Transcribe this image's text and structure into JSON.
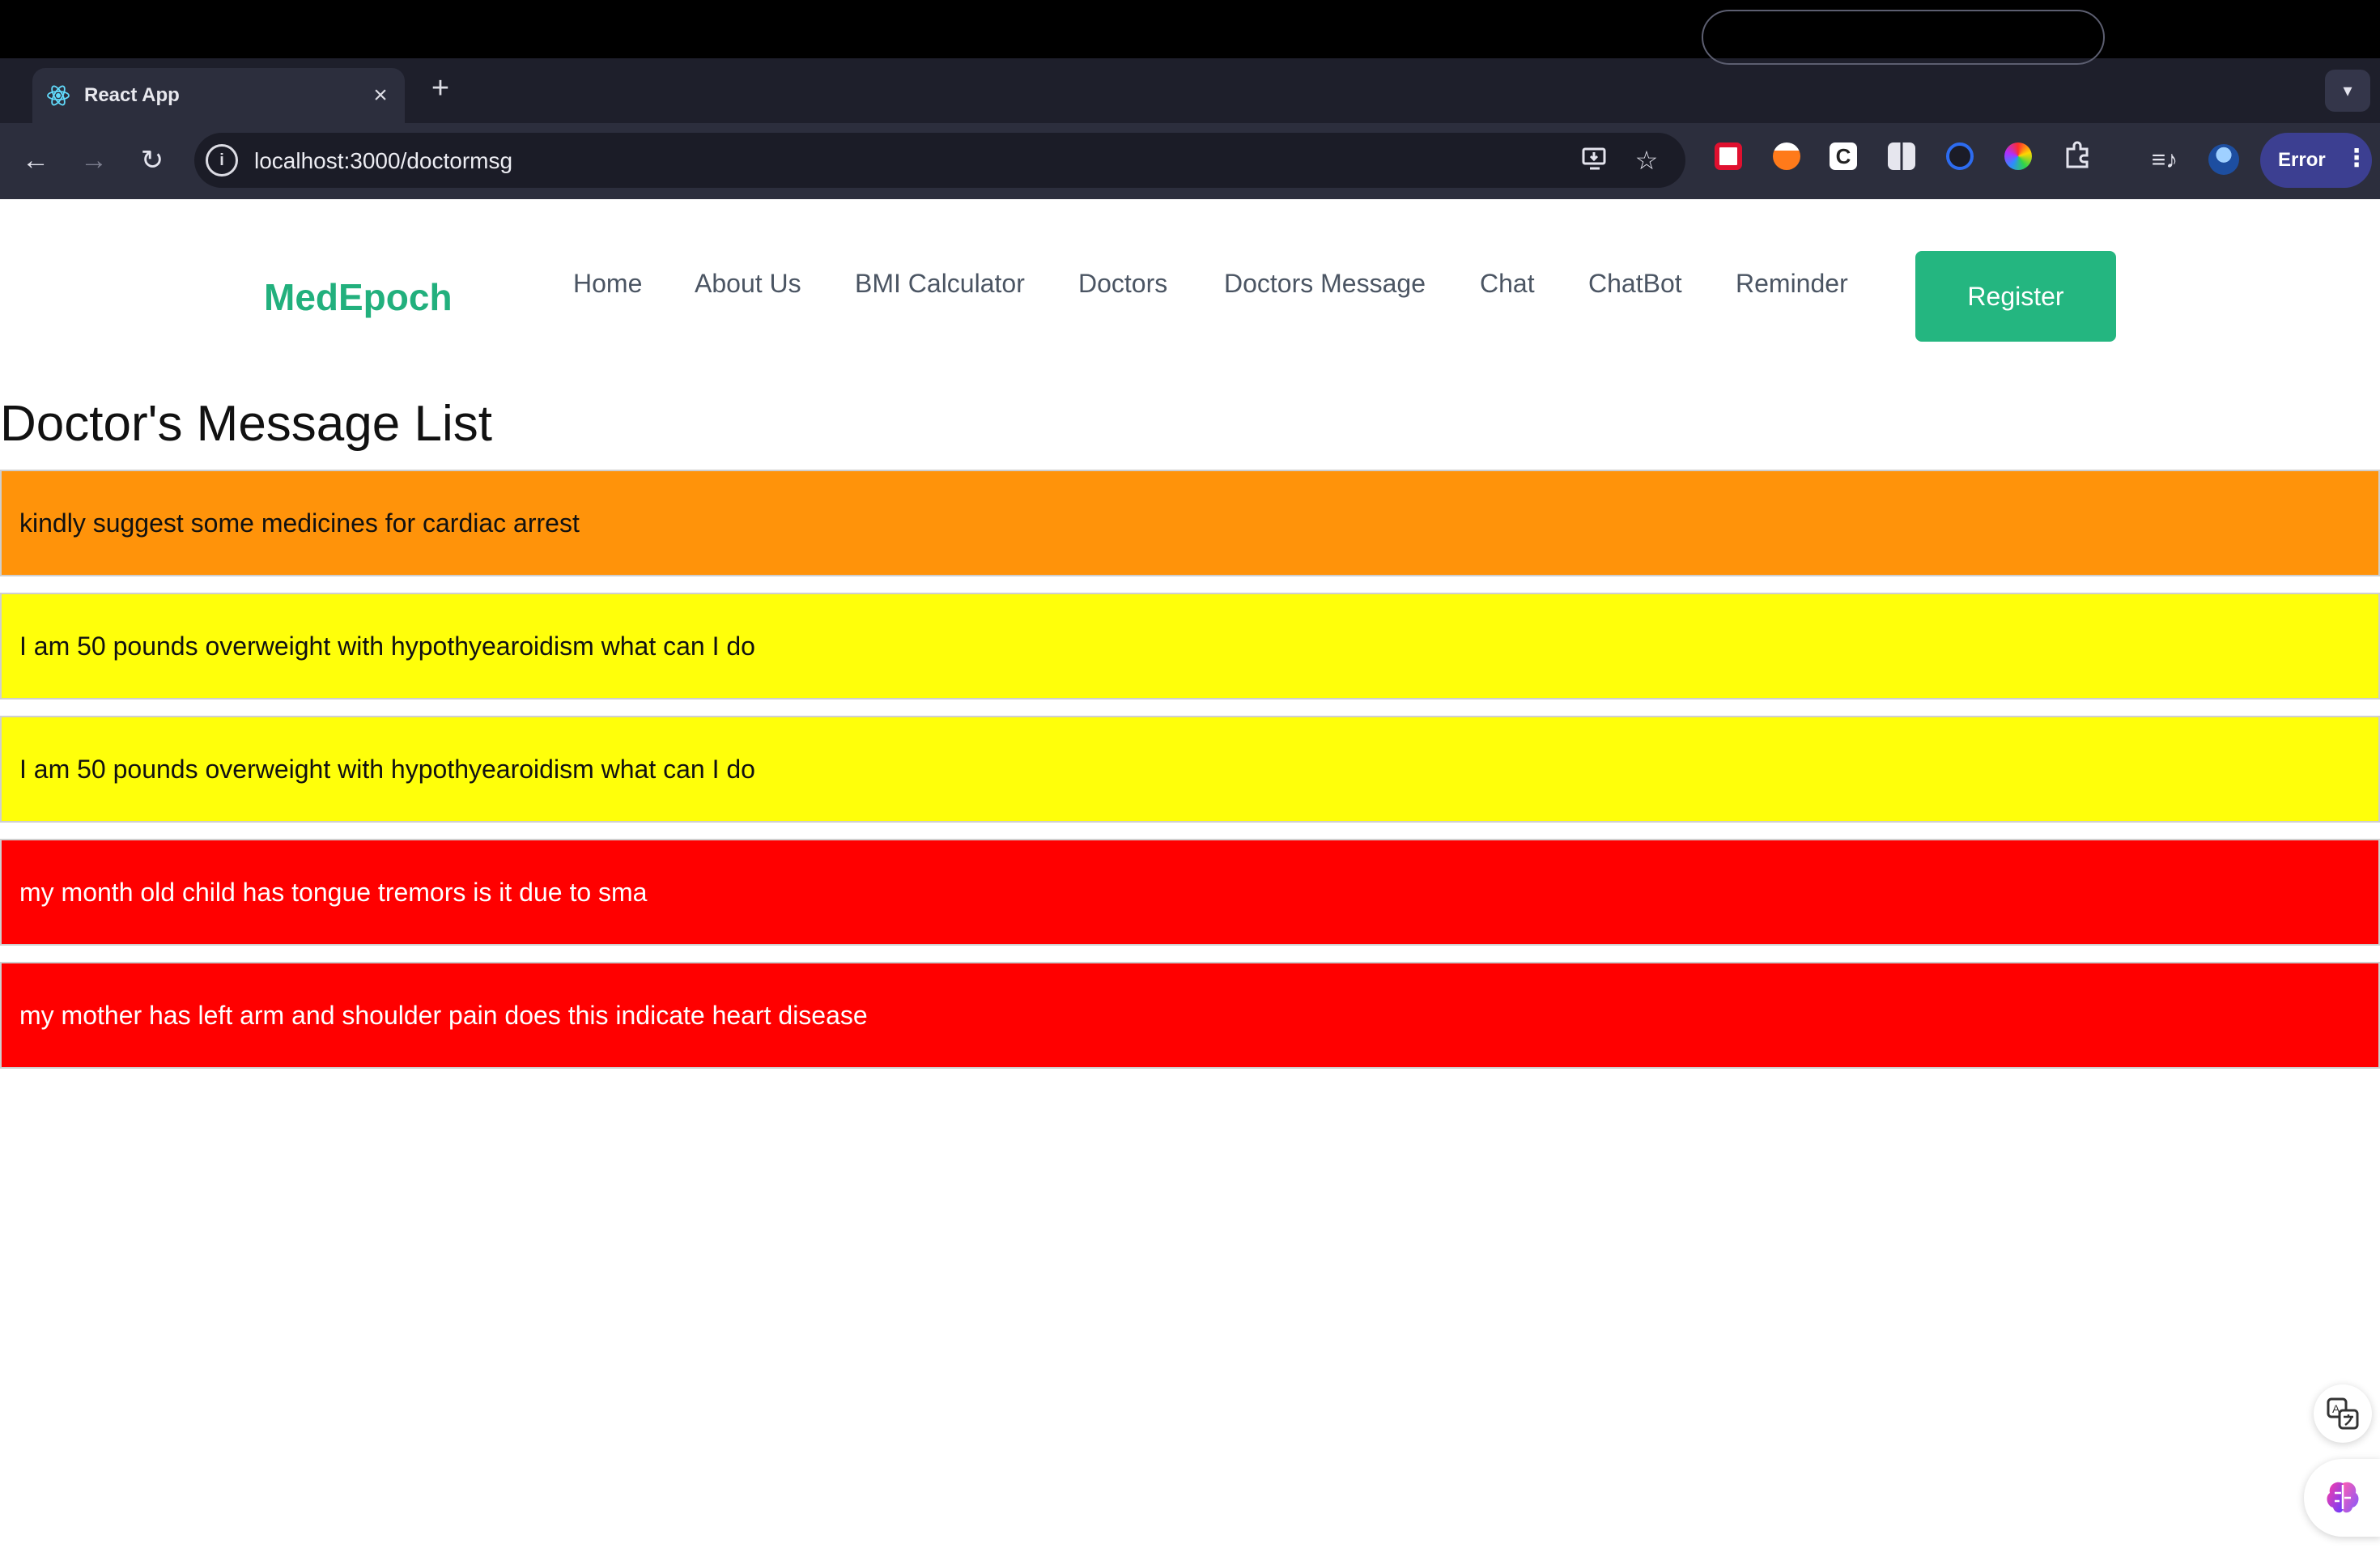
{
  "browser": {
    "tab_title": "React App",
    "url": "localhost:3000/doctormsg",
    "profile_status": "Error",
    "extensions": [
      "record-extension-icon",
      "dropper-extension-icon",
      "c-extension-icon",
      "reader-extension-icon",
      "target-extension-icon",
      "color-extension-icon"
    ]
  },
  "header": {
    "logo": "MedEpoch",
    "nav": [
      "Home",
      "About Us",
      "BMI Calculator",
      "Doctors",
      "Doctors Message",
      "Chat",
      "ChatBot",
      "Reminder"
    ],
    "register_label": "Register"
  },
  "main": {
    "title": "Doctor's Message List",
    "messages": [
      {
        "text": "kindly suggest some medicines for cardiac arrest",
        "bg": "#ff930a",
        "fg": "#111111"
      },
      {
        "text": "I am 50 pounds overweight with hypothyearoidism what can I do",
        "bg": "#ffff0a",
        "fg": "#111111"
      },
      {
        "text": "I am 50 pounds overweight with hypothyearoidism what can I do",
        "bg": "#ffff0a",
        "fg": "#111111"
      },
      {
        "text": "my month old child has tongue tremors is it due to sma",
        "bg": "#ff0000",
        "fg": "#ffffff"
      },
      {
        "text": "my mother has left arm and shoulder pain does this indicate heart disease",
        "bg": "#ff0000",
        "fg": "#ffffff"
      }
    ]
  },
  "colors": {
    "brand": "#22b07d",
    "register_bg": "#24b680"
  }
}
